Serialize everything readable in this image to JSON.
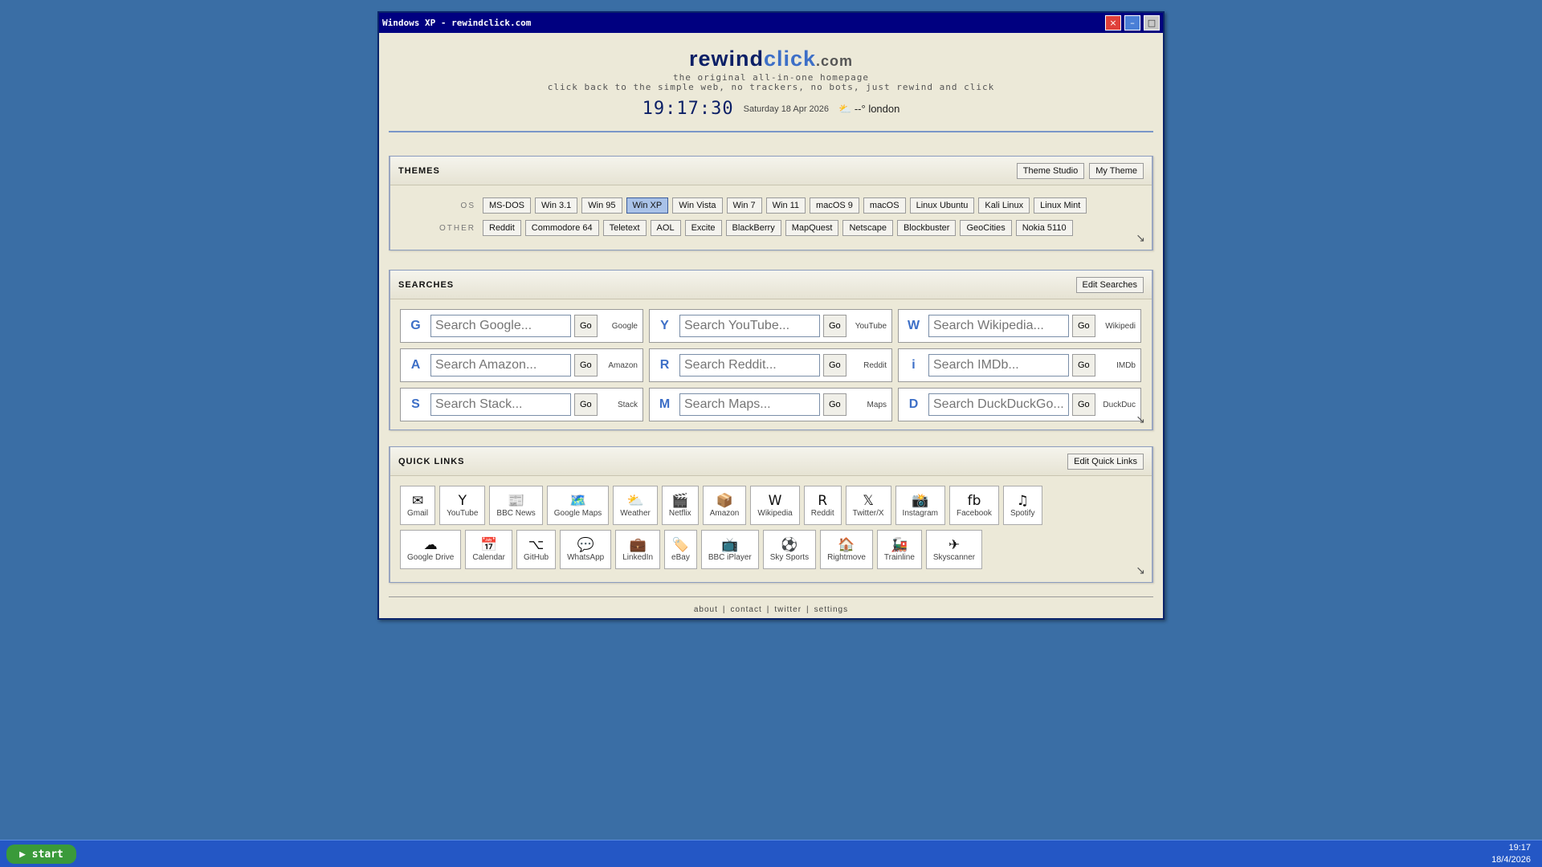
{
  "window": {
    "title": "Windows XP - rewindclick.com",
    "close": "×",
    "minimize": "–",
    "maximize": "□"
  },
  "header": {
    "logo_part1": "rewind",
    "logo_part2": "click",
    "logo_part3": ".com",
    "tagline1": "the original all-in-one homepage",
    "tagline2": "click back to the simple web, no trackers, no bots, just rewind and click",
    "clock": "19:17:30",
    "date": "Saturday 18 Apr 2026",
    "weather_icon": "⛅",
    "weather": "--° london"
  },
  "themes": {
    "title": "THEMES",
    "theme_studio": "Theme Studio",
    "my_theme": "My Theme",
    "os_label": "OS",
    "other_label": "OTHER",
    "os": [
      "MS-DOS",
      "Win 3.1",
      "Win 95",
      "Win XP",
      "Win Vista",
      "Win 7",
      "Win 11",
      "macOS 9",
      "macOS",
      "Linux Ubuntu",
      "Kali Linux",
      "Linux Mint"
    ],
    "other": [
      "Reddit",
      "Commodore 64",
      "Teletext",
      "AOL",
      "Excite",
      "BlackBerry",
      "MapQuest",
      "Netscape",
      "Blockbuster",
      "GeoCities",
      "Nokia 5110"
    ],
    "active": "Win XP"
  },
  "searches": {
    "title": "SEARCHES",
    "edit": "Edit Searches",
    "go": "Go",
    "items": [
      {
        "letter": "G",
        "placeholder": "Search Google...",
        "label": "Google"
      },
      {
        "letter": "Y",
        "placeholder": "Search YouTube...",
        "label": "YouTube"
      },
      {
        "letter": "W",
        "placeholder": "Search Wikipedia...",
        "label": "Wikipedi"
      },
      {
        "letter": "A",
        "placeholder": "Search Amazon...",
        "label": "Amazon"
      },
      {
        "letter": "R",
        "placeholder": "Search Reddit...",
        "label": "Reddit"
      },
      {
        "letter": "i",
        "placeholder": "Search IMDb...",
        "label": "IMDb"
      },
      {
        "letter": "S",
        "placeholder": "Search Stack...",
        "label": "Stack"
      },
      {
        "letter": "M",
        "placeholder": "Search Maps...",
        "label": "Maps"
      },
      {
        "letter": "D",
        "placeholder": "Search DuckDuckGo...",
        "label": "DuckDuc"
      }
    ]
  },
  "quicklinks": {
    "title": "QUICK LINKS",
    "edit": "Edit Quick Links",
    "row1": [
      {
        "icon": "✉",
        "label": "Gmail",
        "name": "mail-icon"
      },
      {
        "icon": "Y",
        "label": "YouTube",
        "name": "youtube-icon"
      },
      {
        "icon": "📰",
        "label": "BBC News",
        "name": "newspaper-icon"
      },
      {
        "icon": "🗺️",
        "label": "Google Maps",
        "name": "map-icon"
      },
      {
        "icon": "⛅",
        "label": "Weather",
        "name": "weather-icon"
      },
      {
        "icon": "🎬",
        "label": "Netflix",
        "name": "clapper-icon"
      },
      {
        "icon": "📦",
        "label": "Amazon",
        "name": "package-icon"
      },
      {
        "icon": "W",
        "label": "Wikipedia",
        "name": "wikipedia-icon"
      },
      {
        "icon": "R",
        "label": "Reddit",
        "name": "reddit-icon"
      },
      {
        "icon": "𝕏",
        "label": "Twitter/X",
        "name": "x-icon"
      },
      {
        "icon": "📸",
        "label": "Instagram",
        "name": "camera-icon"
      },
      {
        "icon": "fb",
        "label": "Facebook",
        "name": "facebook-icon"
      },
      {
        "icon": "♫",
        "label": "Spotify",
        "name": "music-icon"
      }
    ],
    "row2": [
      {
        "icon": "☁",
        "label": "Google Drive",
        "name": "cloud-icon"
      },
      {
        "icon": "📅",
        "label": "Calendar",
        "name": "calendar-icon"
      },
      {
        "icon": "⌥",
        "label": "GitHub",
        "name": "github-icon"
      },
      {
        "icon": "💬",
        "label": "WhatsApp",
        "name": "chat-icon"
      },
      {
        "icon": "💼",
        "label": "LinkedIn",
        "name": "briefcase-icon"
      },
      {
        "icon": "🏷️",
        "label": "eBay",
        "name": "tag-icon"
      },
      {
        "icon": "📺",
        "label": "BBC iPlayer",
        "name": "tv-icon"
      },
      {
        "icon": "⚽",
        "label": "Sky Sports",
        "name": "football-icon"
      },
      {
        "icon": "🏠",
        "label": "Rightmove",
        "name": "house-icon"
      },
      {
        "icon": "🚂",
        "label": "Trainline",
        "name": "train-icon"
      },
      {
        "icon": "✈",
        "label": "Skyscanner",
        "name": "plane-icon"
      }
    ]
  },
  "footer": {
    "links": [
      "about",
      "contact",
      "twitter",
      "settings"
    ],
    "sep": "|"
  },
  "taskbar": {
    "start": "▶ start",
    "time": "19:17",
    "date": "18/4/2026"
  },
  "colors": {
    "desktop": "#3a6ea5",
    "titlebar": "#000080",
    "accent": "#3d6fc7",
    "logo_dark": "#0b1f66"
  }
}
